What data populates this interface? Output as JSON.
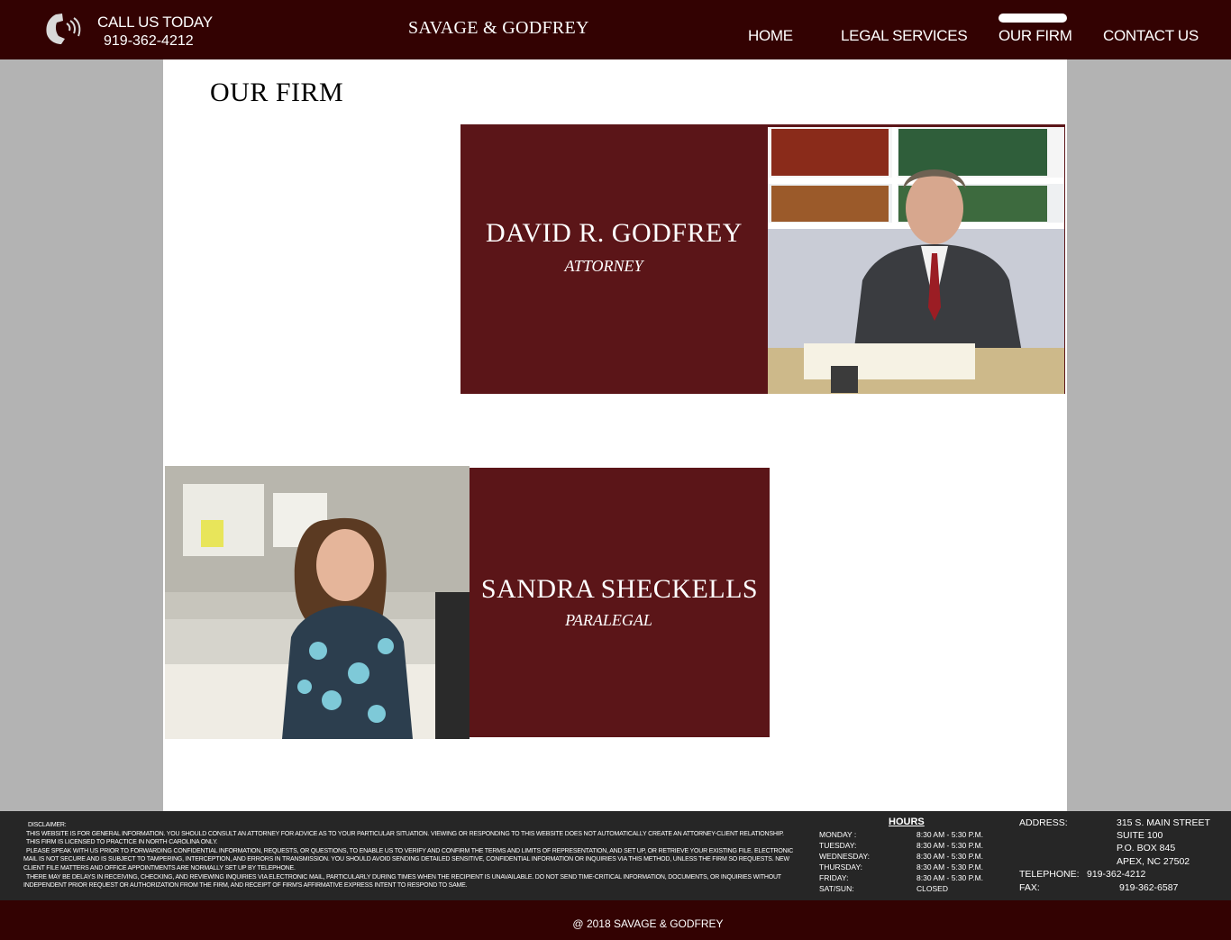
{
  "header": {
    "call_label": "CALL US TODAY",
    "call_number": "919-362-4212",
    "brand": "SAVAGE & GODFREY",
    "nav": [
      {
        "label": "HOME"
      },
      {
        "label": "LEGAL SERVICES"
      },
      {
        "label": "OUR FIRM",
        "active": true
      },
      {
        "label": "CONTACT US"
      }
    ]
  },
  "main": {
    "title": "OUR FIRM",
    "people": [
      {
        "name": "DAVID R. GODFREY",
        "role": "ATTORNEY"
      },
      {
        "name": "SANDRA SHECKELLS",
        "role": "PARALEGAL"
      }
    ]
  },
  "footer": {
    "disclaimer": [
      "DISCLAIMER:",
      "THIS WEBSITE IS FOR GENERAL INFORMATION. YOU SHOULD CONSULT AN ATTORNEY FOR ADVICE AS TO YOUR PARTICULAR SITUATION. VIEWING OR RESPONDING TO THIS WEBSITE DOES NOT AUTOMATICALLY CREATE AN ATTORNEY-CLIENT RELATIONSHIP.",
      "THIS FIRM IS LICENSED TO PRACTICE IN NORTH CAROLINA ONLY.",
      "PLEASE SPEAK WITH US PRIOR TO FORWARDING CONFIDENTIAL INFORMATION, REQUESTS, OR QUESTIONS, TO ENABLE US TO VERIFY AND CONFIRM THE TERMS AND LIMITS OF REPRESENTATION, AND SET UP, OR RETRIEVE YOUR EXISTING FILE. ELECTRONIC MAIL IS NOT SECURE AND IS SUBJECT TO TAMPERING, INTERCEPTION, AND ERRORS IN TRANSMISSION. YOU SHOULD AVOID SENDING DETAILED SENSITIVE, CONFIDENTIAL INFORMATION OR INQUIRIES VIA THIS METHOD, UNLESS THE FIRM SO REQUESTS. NEW CLIENT FILE MATTERS AND OFFICE APPOINTMENTS ARE NORMALLY SET UP BY TELEPHONE.",
      "THERE MAY BE DELAYS IN RECEIVING, CHECKING, AND REVIEWING INQUIRIES VIA ELECTRONIC MAIL, PARTICULARLY DURING TIMES WHEN THE RECIPIENT IS UNAVAILABLE. DO NOT SEND TIME-CRITICAL INFORMATION, DOCUMENTS, OR INQUIRIES WITHOUT INDEPENDENT PRIOR REQUEST OR AUTHORIZATION FROM THE FIRM, AND RECEIPT OF FIRM'S AFFIRMATIVE EXPRESS INTENT TO RESPOND TO SAME."
    ],
    "hours_title": "HOURS",
    "hours": [
      {
        "day": "MONDAY :",
        "time": "8:30 AM - 5:30 P.M."
      },
      {
        "day": "TUESDAY:",
        "time": "8:30 AM - 5:30 P.M."
      },
      {
        "day": "WEDNESDAY:",
        "time": "8:30 AM - 5:30 P.M."
      },
      {
        "day": "THURSDAY:",
        "time": "8:30 AM - 5:30 P.M."
      },
      {
        "day": "FRIDAY:",
        "time": "8:30 AM - 5:30 P.M."
      },
      {
        "day": "SAT/SUN:",
        "time": "CLOSED"
      }
    ],
    "address_label": "ADDRESS:",
    "address_lines": [
      "315 S. MAIN STREET",
      "SUITE 100",
      "P.O. BOX 845",
      "APEX, NC 27502"
    ],
    "telephone_label": "TELEPHONE:",
    "telephone": "919-362-4212",
    "fax_label": "FAX:",
    "fax": "919-362-6587",
    "copyright": "@ 2018 SAVAGE & GODFREY"
  }
}
